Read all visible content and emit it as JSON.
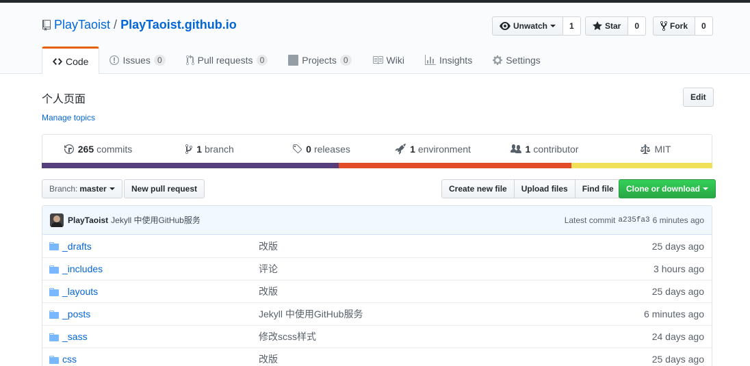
{
  "repo": {
    "owner": "PlayTaoist",
    "separator": "/",
    "name": "PlayTaoist.github.io"
  },
  "actions": {
    "watch_label": "Unwatch",
    "watch_count": "1",
    "star_label": "Star",
    "star_count": "0",
    "fork_label": "Fork",
    "fork_count": "0"
  },
  "tabs": [
    {
      "label": "Code"
    },
    {
      "label": "Issues",
      "count": "0"
    },
    {
      "label": "Pull requests",
      "count": "0"
    },
    {
      "label": "Projects",
      "count": "0"
    },
    {
      "label": "Wiki"
    },
    {
      "label": "Insights"
    },
    {
      "label": "Settings"
    }
  ],
  "about": {
    "description": "个人页面",
    "manage_topics": "Manage topics",
    "edit_label": "Edit"
  },
  "summary": {
    "commits_num": "265",
    "commits_label": "commits",
    "branch_num": "1",
    "branch_label": "branch",
    "releases_num": "0",
    "releases_label": "releases",
    "env_num": "1",
    "env_label": "environment",
    "contrib_num": "1",
    "contrib_label": "contributor",
    "license": "MIT"
  },
  "languages": [
    {
      "color": "#563d7c",
      "fraction": 0.443
    },
    {
      "color": "#e34c26",
      "fraction": 0.347
    },
    {
      "color": "#f1e05a",
      "fraction": 0.21
    }
  ],
  "filenav": {
    "branch_prefix": "Branch:",
    "branch_name": "master",
    "new_pr": "New pull request",
    "create_file": "Create new file",
    "upload_files": "Upload files",
    "find_file": "Find file",
    "clone": "Clone or download"
  },
  "commit": {
    "author": "PlayTaoist",
    "message": "Jekyll 中使用GitHub服务",
    "latest_label": "Latest commit",
    "sha": "a235fa3",
    "age": "6 minutes ago"
  },
  "files": [
    {
      "name": "_drafts",
      "message": "改版",
      "age": "25 days ago"
    },
    {
      "name": "_includes",
      "message": "评论",
      "age": "3 hours ago"
    },
    {
      "name": "_layouts",
      "message": "改版",
      "age": "25 days ago"
    },
    {
      "name": "_posts",
      "message": "Jekyll 中使用GitHub服务",
      "age": "6 minutes ago"
    },
    {
      "name": "_sass",
      "message": "修改scss样式",
      "age": "24 days ago"
    },
    {
      "name": "css",
      "message": "改版",
      "age": "25 days ago"
    }
  ],
  "colors": {
    "link": "#0366d6",
    "accent_tab": "#e36209",
    "clone_green": "#28a745"
  }
}
